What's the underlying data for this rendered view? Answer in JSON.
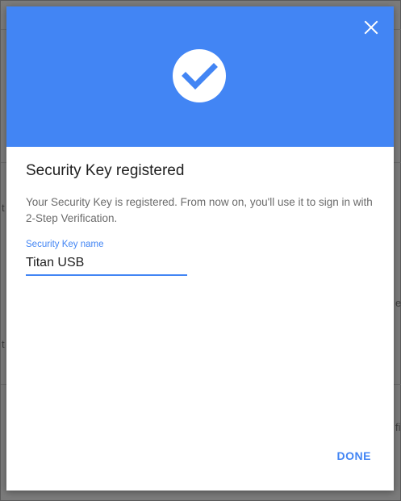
{
  "dialog": {
    "close_icon": "close-icon",
    "success_icon": "checkmark-circle-icon",
    "header_color": "#4285f4",
    "title": "Security Key registered",
    "description": "Your Security Key is registered. From now on, you'll use it to sign in with 2-Step Verification.",
    "field": {
      "label": "Security Key name",
      "value": "Titan USB"
    },
    "done_label": "DONE",
    "accent_color": "#4285f4"
  },
  "background_fragments": {
    "left_mid": "t",
    "left_lower": "t",
    "right_mid": "e",
    "right_lower": "fi"
  }
}
